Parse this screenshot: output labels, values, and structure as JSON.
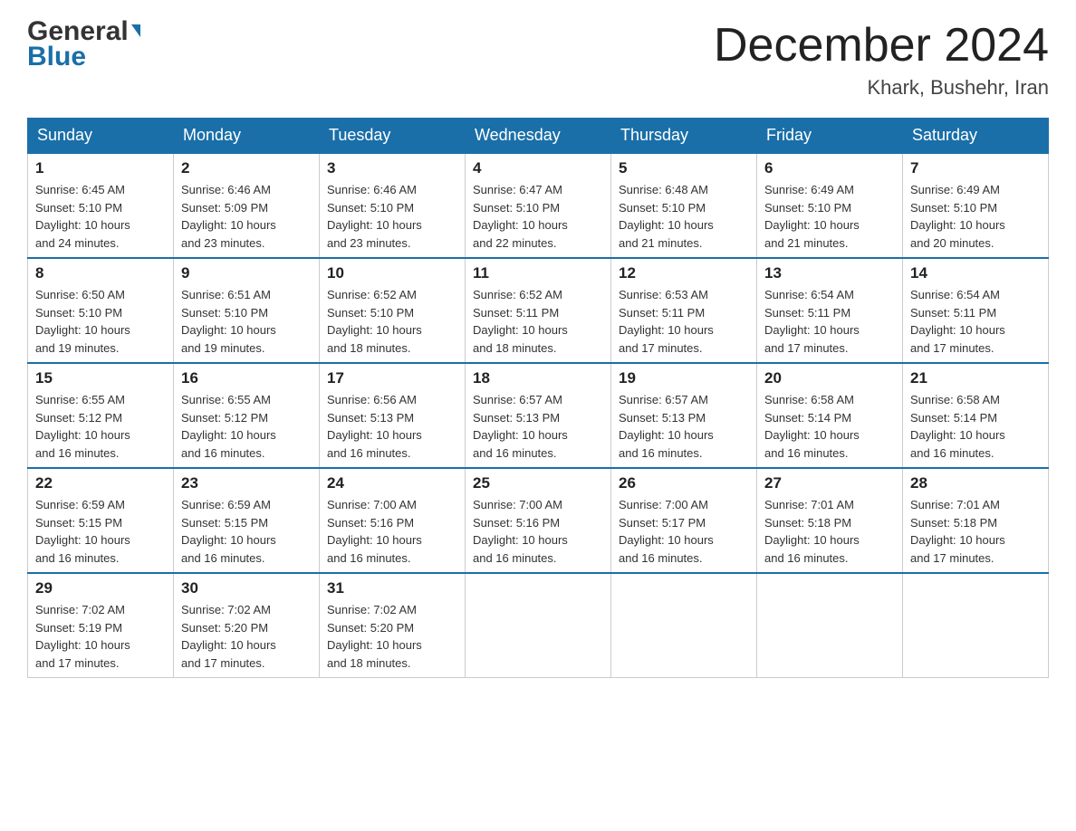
{
  "header": {
    "logo_general": "General",
    "logo_blue": "Blue",
    "title": "December 2024",
    "location": "Khark, Bushehr, Iran"
  },
  "days_of_week": [
    "Sunday",
    "Monday",
    "Tuesday",
    "Wednesday",
    "Thursday",
    "Friday",
    "Saturday"
  ],
  "weeks": [
    [
      {
        "day": "1",
        "sunrise": "6:45 AM",
        "sunset": "5:10 PM",
        "daylight": "10 hours and 24 minutes."
      },
      {
        "day": "2",
        "sunrise": "6:46 AM",
        "sunset": "5:09 PM",
        "daylight": "10 hours and 23 minutes."
      },
      {
        "day": "3",
        "sunrise": "6:46 AM",
        "sunset": "5:10 PM",
        "daylight": "10 hours and 23 minutes."
      },
      {
        "day": "4",
        "sunrise": "6:47 AM",
        "sunset": "5:10 PM",
        "daylight": "10 hours and 22 minutes."
      },
      {
        "day": "5",
        "sunrise": "6:48 AM",
        "sunset": "5:10 PM",
        "daylight": "10 hours and 21 minutes."
      },
      {
        "day": "6",
        "sunrise": "6:49 AM",
        "sunset": "5:10 PM",
        "daylight": "10 hours and 21 minutes."
      },
      {
        "day": "7",
        "sunrise": "6:49 AM",
        "sunset": "5:10 PM",
        "daylight": "10 hours and 20 minutes."
      }
    ],
    [
      {
        "day": "8",
        "sunrise": "6:50 AM",
        "sunset": "5:10 PM",
        "daylight": "10 hours and 19 minutes."
      },
      {
        "day": "9",
        "sunrise": "6:51 AM",
        "sunset": "5:10 PM",
        "daylight": "10 hours and 19 minutes."
      },
      {
        "day": "10",
        "sunrise": "6:52 AM",
        "sunset": "5:10 PM",
        "daylight": "10 hours and 18 minutes."
      },
      {
        "day": "11",
        "sunrise": "6:52 AM",
        "sunset": "5:11 PM",
        "daylight": "10 hours and 18 minutes."
      },
      {
        "day": "12",
        "sunrise": "6:53 AM",
        "sunset": "5:11 PM",
        "daylight": "10 hours and 17 minutes."
      },
      {
        "day": "13",
        "sunrise": "6:54 AM",
        "sunset": "5:11 PM",
        "daylight": "10 hours and 17 minutes."
      },
      {
        "day": "14",
        "sunrise": "6:54 AM",
        "sunset": "5:11 PM",
        "daylight": "10 hours and 17 minutes."
      }
    ],
    [
      {
        "day": "15",
        "sunrise": "6:55 AM",
        "sunset": "5:12 PM",
        "daylight": "10 hours and 16 minutes."
      },
      {
        "day": "16",
        "sunrise": "6:55 AM",
        "sunset": "5:12 PM",
        "daylight": "10 hours and 16 minutes."
      },
      {
        "day": "17",
        "sunrise": "6:56 AM",
        "sunset": "5:13 PM",
        "daylight": "10 hours and 16 minutes."
      },
      {
        "day": "18",
        "sunrise": "6:57 AM",
        "sunset": "5:13 PM",
        "daylight": "10 hours and 16 minutes."
      },
      {
        "day": "19",
        "sunrise": "6:57 AM",
        "sunset": "5:13 PM",
        "daylight": "10 hours and 16 minutes."
      },
      {
        "day": "20",
        "sunrise": "6:58 AM",
        "sunset": "5:14 PM",
        "daylight": "10 hours and 16 minutes."
      },
      {
        "day": "21",
        "sunrise": "6:58 AM",
        "sunset": "5:14 PM",
        "daylight": "10 hours and 16 minutes."
      }
    ],
    [
      {
        "day": "22",
        "sunrise": "6:59 AM",
        "sunset": "5:15 PM",
        "daylight": "10 hours and 16 minutes."
      },
      {
        "day": "23",
        "sunrise": "6:59 AM",
        "sunset": "5:15 PM",
        "daylight": "10 hours and 16 minutes."
      },
      {
        "day": "24",
        "sunrise": "7:00 AM",
        "sunset": "5:16 PM",
        "daylight": "10 hours and 16 minutes."
      },
      {
        "day": "25",
        "sunrise": "7:00 AM",
        "sunset": "5:16 PM",
        "daylight": "10 hours and 16 minutes."
      },
      {
        "day": "26",
        "sunrise": "7:00 AM",
        "sunset": "5:17 PM",
        "daylight": "10 hours and 16 minutes."
      },
      {
        "day": "27",
        "sunrise": "7:01 AM",
        "sunset": "5:18 PM",
        "daylight": "10 hours and 16 minutes."
      },
      {
        "day": "28",
        "sunrise": "7:01 AM",
        "sunset": "5:18 PM",
        "daylight": "10 hours and 17 minutes."
      }
    ],
    [
      {
        "day": "29",
        "sunrise": "7:02 AM",
        "sunset": "5:19 PM",
        "daylight": "10 hours and 17 minutes."
      },
      {
        "day": "30",
        "sunrise": "7:02 AM",
        "sunset": "5:20 PM",
        "daylight": "10 hours and 17 minutes."
      },
      {
        "day": "31",
        "sunrise": "7:02 AM",
        "sunset": "5:20 PM",
        "daylight": "10 hours and 18 minutes."
      },
      null,
      null,
      null,
      null
    ]
  ],
  "labels": {
    "sunrise": "Sunrise:",
    "sunset": "Sunset:",
    "daylight": "Daylight:"
  }
}
